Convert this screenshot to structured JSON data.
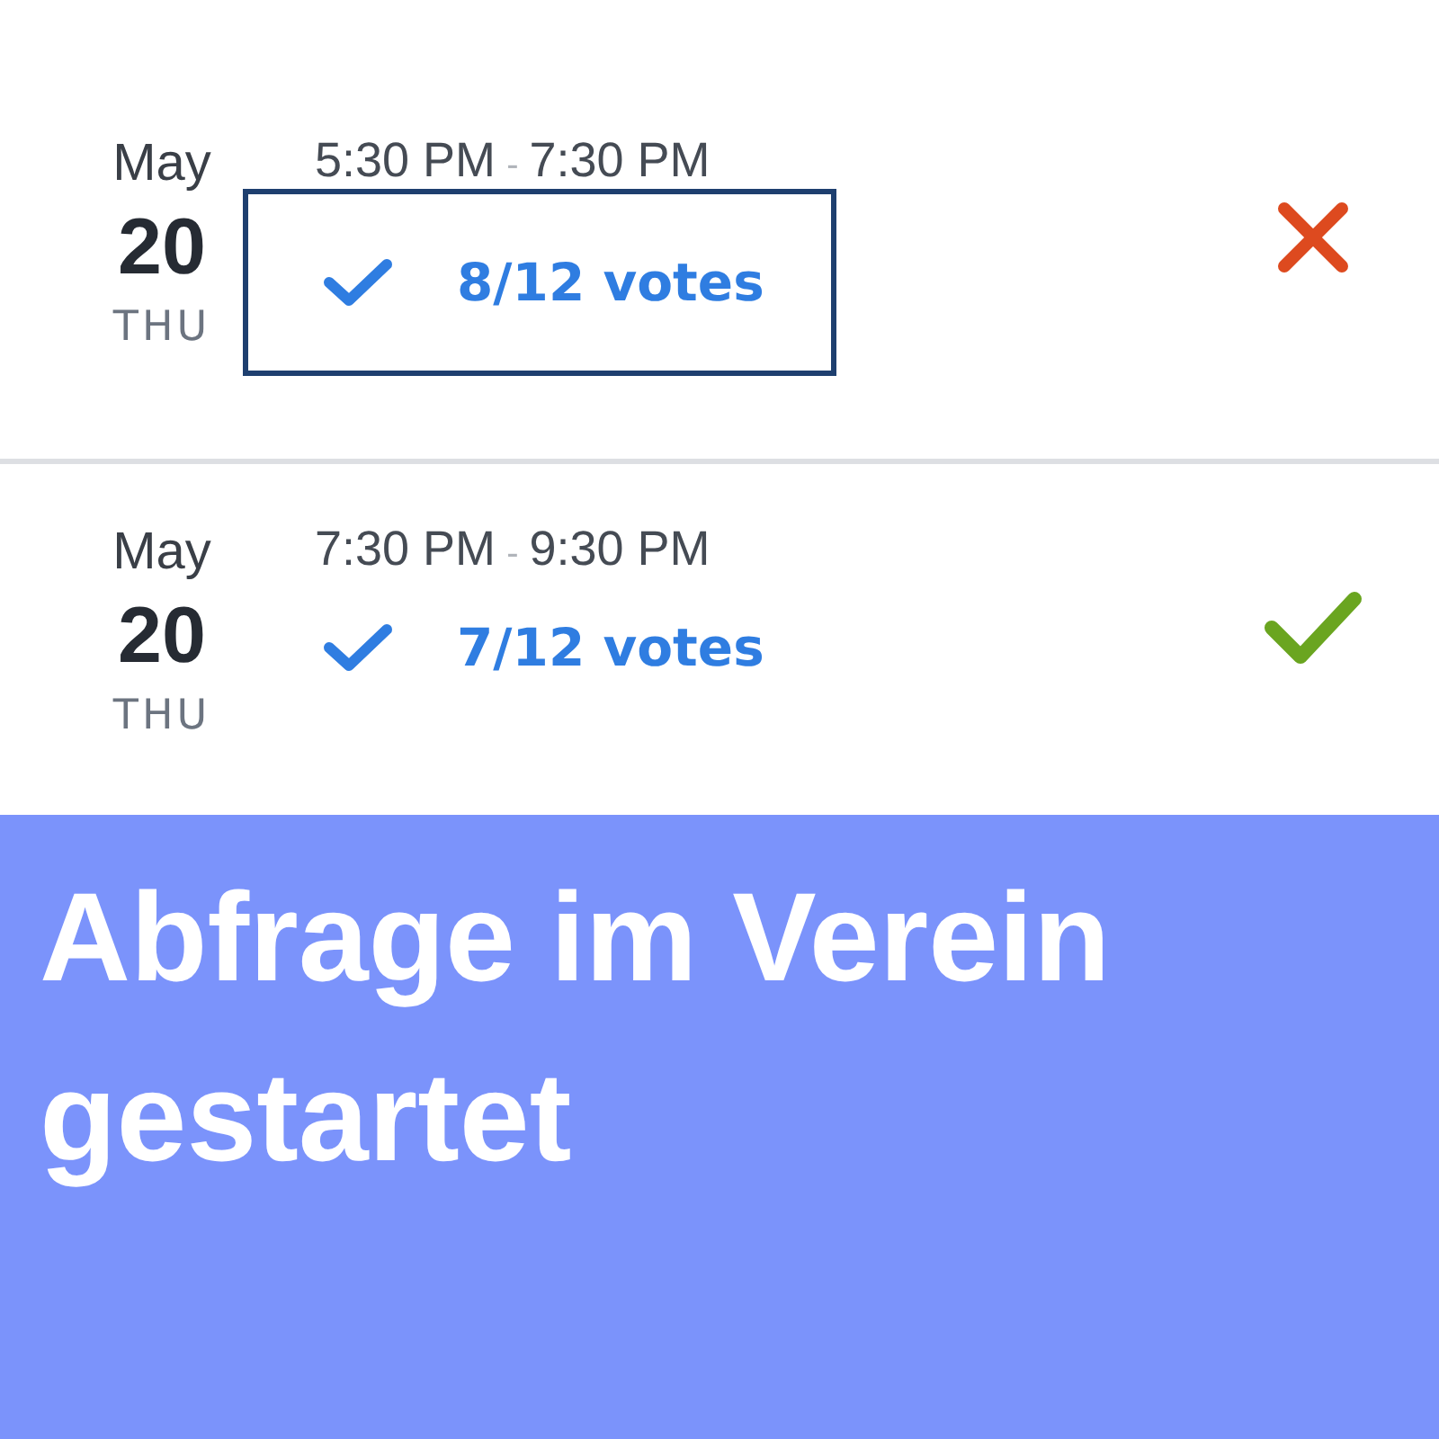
{
  "slots": [
    {
      "month": "May",
      "day": "20",
      "weekday": "THU",
      "start": "5:30 PM",
      "separator": "-",
      "end": "7:30 PM",
      "votes": "8/12 votes",
      "highlighted": true,
      "accepted": false
    },
    {
      "month": "May",
      "day": "20",
      "weekday": "THU",
      "start": "7:30 PM",
      "separator": "-",
      "end": "9:30 PM",
      "votes": "7/12 votes",
      "highlighted": false,
      "accepted": true
    }
  ],
  "banner": {
    "headline": "Abfrage im Verein gestartet"
  }
}
